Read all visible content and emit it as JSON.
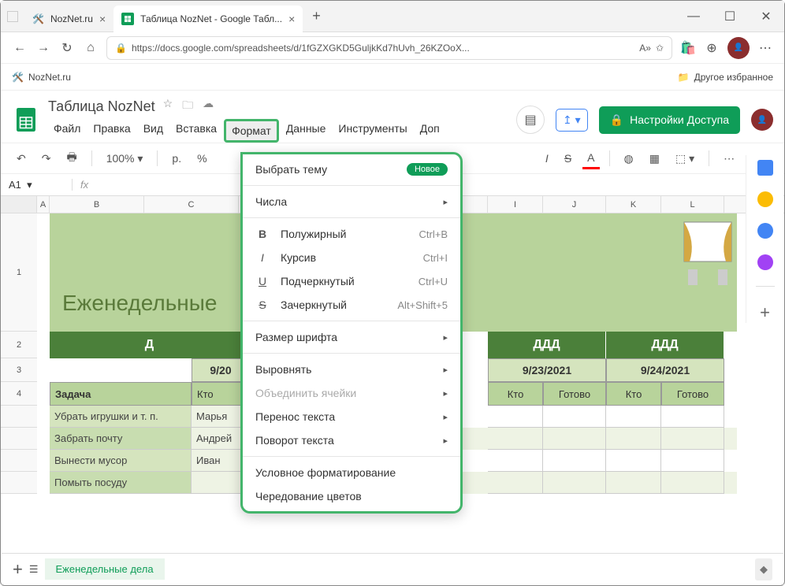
{
  "browser": {
    "tabs": [
      {
        "title": "NozNet.ru",
        "active": false
      },
      {
        "title": "Таблица NozNet - Google Табл...",
        "active": true
      }
    ],
    "url": "https://docs.google.com/spreadsheets/d/1fGZXGKD5GuljkKd7hUvh_26KZOoX...",
    "bookmark_left": "NozNet.ru",
    "bookmark_right": "Другое избранное"
  },
  "doc": {
    "title": "Таблица NozNet",
    "share_label": "Настройки Доступа"
  },
  "menubar": [
    "Файл",
    "Правка",
    "Вид",
    "Вставка",
    "Формат",
    "Данные",
    "Инструменты",
    "Доп"
  ],
  "toolbar": {
    "zoom": "100%",
    "currency_rub": "р.",
    "percent": "%"
  },
  "cell_ref": "A1",
  "banner_title": "Еженедельные ",
  "columns": [
    "A",
    "B",
    "C",
    "",
    "",
    "",
    "",
    "I",
    "J",
    "K",
    "L"
  ],
  "row_nums": [
    "1",
    "2",
    "3",
    "4"
  ],
  "table": {
    "day_headers": [
      "Д",
      "ДДД",
      "ДДД"
    ],
    "dates": [
      "9/20",
      "9/23/2021",
      "9/24/2021"
    ],
    "sub_headers": [
      "Задача",
      "Кто",
      "Кто",
      "Готово",
      "Кто",
      "Готово"
    ],
    "rows": [
      {
        "task": "Убрать игрушки и т. п.",
        "who": "Марья"
      },
      {
        "task": "Забрать почту",
        "who": "Андрей"
      },
      {
        "task": "Вынести мусор",
        "who": "Иван"
      },
      {
        "task": "Помыть посуду",
        "who": ""
      }
    ]
  },
  "dropdown": {
    "theme": "Выбрать тему",
    "theme_badge": "Новое",
    "numbers": "Числа",
    "bold": "Полужирный",
    "bold_sc": "Ctrl+B",
    "italic": "Курсив",
    "italic_sc": "Ctrl+I",
    "underline": "Подчеркнутый",
    "underline_sc": "Ctrl+U",
    "strike": "Зачеркнутый",
    "strike_sc": "Alt+Shift+5",
    "fontsize": "Размер шрифта",
    "align": "Выровнять",
    "merge": "Объединить ячейки",
    "wrap": "Перенос текста",
    "rotate": "Поворот текста",
    "conditional": "Условное форматирование",
    "altcolors": "Чередование цветов"
  },
  "sheet_tab": "Еженедельные дела "
}
